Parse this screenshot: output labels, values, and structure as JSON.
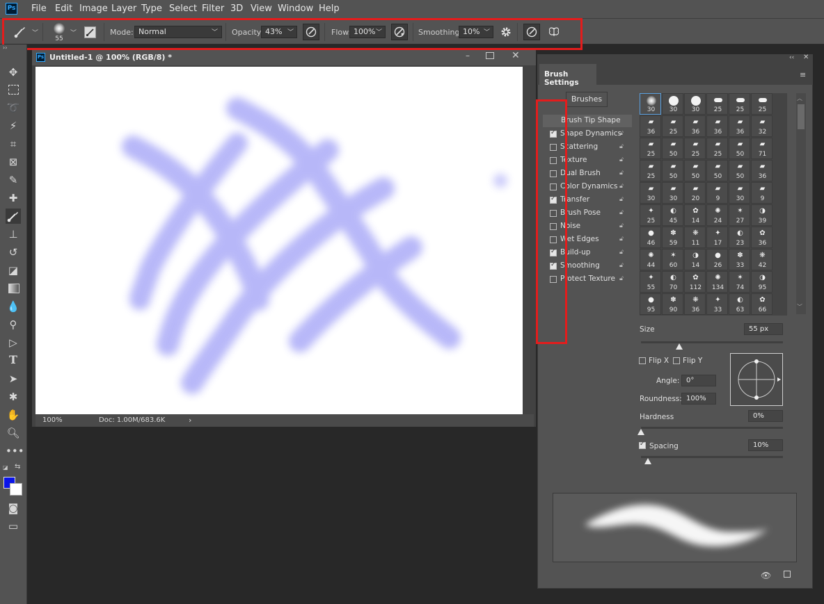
{
  "app": {
    "logo": "Ps",
    "menu": [
      "File",
      "Edit",
      "Image",
      "Layer",
      "Type",
      "Select",
      "Filter",
      "3D",
      "View",
      "Window",
      "Help"
    ]
  },
  "options_bar": {
    "brush_size": "55",
    "mode_label": "Mode:",
    "mode_value": "Normal",
    "opacity_label": "Opacity:",
    "opacity_value": "43%",
    "flow_label": "Flow:",
    "flow_value": "100%",
    "smoothing_label": "Smoothing:",
    "smoothing_value": "10%",
    "icons": [
      "brush-tool-icon",
      "brush-preset-icon",
      "brush-panel-toggle-icon",
      "pressure-opacity-icon",
      "airbrush-icon",
      "settings-gear-icon",
      "pressure-size-icon",
      "symmetry-icon"
    ]
  },
  "document": {
    "title": "Untitled-1 @ 100% (RGB/8) *",
    "zoom": "100%",
    "doc_info": "Doc: 1.00M/683.6K",
    "brush_color": "#5a5af0"
  },
  "toolbar": {
    "foreground_color": "#0a14e8",
    "background_color": "#ffffff"
  },
  "brush_panel": {
    "tab": "Brush Settings",
    "brushes_button": "Brushes",
    "settings": [
      {
        "label": "Brush Tip Shape",
        "checkbox": false,
        "checked": false
      },
      {
        "label": "Shape Dynamics",
        "checkbox": true,
        "checked": true
      },
      {
        "label": "Scattering",
        "checkbox": true,
        "checked": false
      },
      {
        "label": "Texture",
        "checkbox": true,
        "checked": false
      },
      {
        "label": "Dual Brush",
        "checkbox": true,
        "checked": false
      },
      {
        "label": "Color Dynamics",
        "checkbox": true,
        "checked": false
      },
      {
        "label": "Transfer",
        "checkbox": true,
        "checked": true
      },
      {
        "label": "Brush Pose",
        "checkbox": true,
        "checked": false
      },
      {
        "label": "Noise",
        "checkbox": true,
        "checked": false
      },
      {
        "label": "Wet Edges",
        "checkbox": true,
        "checked": false
      },
      {
        "label": "Build-up",
        "checkbox": true,
        "checked": true
      },
      {
        "label": "Smoothing",
        "checkbox": true,
        "checked": true
      },
      {
        "label": "Protect Texture",
        "checkbox": true,
        "checked": false
      }
    ],
    "presets": [
      "30",
      "30",
      "30",
      "25",
      "25",
      "25",
      "36",
      "25",
      "36",
      "36",
      "36",
      "32",
      "25",
      "50",
      "25",
      "25",
      "50",
      "71",
      "25",
      "50",
      "50",
      "50",
      "50",
      "36",
      "30",
      "30",
      "20",
      "9",
      "30",
      "9",
      "25",
      "45",
      "14",
      "24",
      "27",
      "39",
      "46",
      "59",
      "11",
      "17",
      "23",
      "36",
      "44",
      "60",
      "14",
      "26",
      "33",
      "42",
      "55",
      "70",
      "112",
      "134",
      "74",
      "95",
      "95",
      "90",
      "36",
      "33",
      "63",
      "66"
    ],
    "size_label": "Size",
    "size_value": "55 px",
    "size_fraction": 0.27,
    "flip_x": "Flip X",
    "flip_y": "Flip Y",
    "angle_label": "Angle:",
    "angle_value": "0°",
    "roundness_label": "Roundness:",
    "roundness_value": "100%",
    "hardness_label": "Hardness",
    "hardness_value": "0%",
    "hardness_fraction": 0,
    "spacing_label": "Spacing",
    "spacing_value": "10%",
    "spacing_checked": true,
    "spacing_fraction": 0.05
  }
}
